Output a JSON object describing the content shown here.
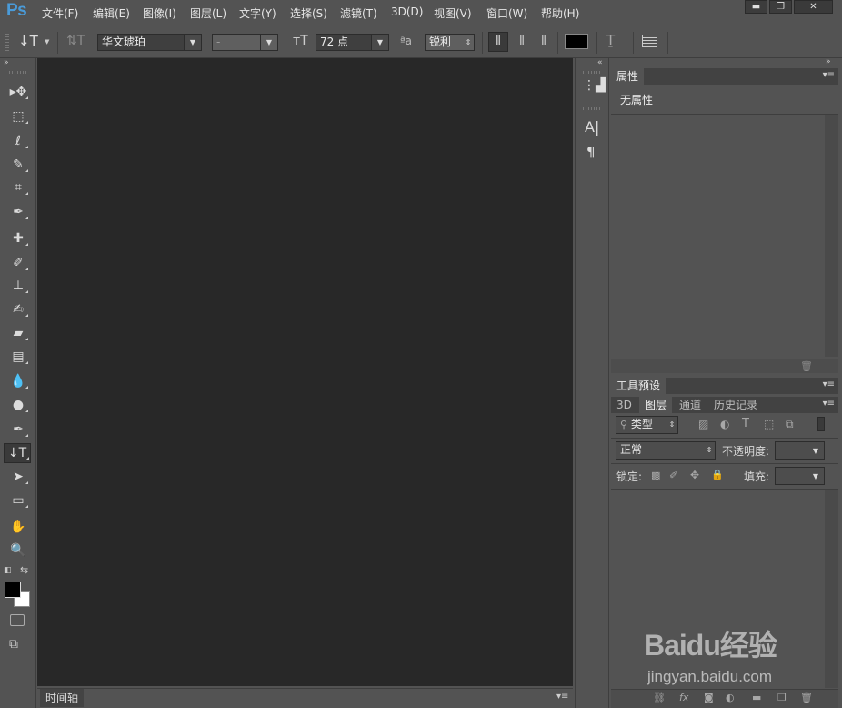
{
  "app": {
    "logo": "Ps"
  },
  "menu": [
    "文件(F)",
    "编辑(E)",
    "图像(I)",
    "图层(L)",
    "文字(Y)",
    "选择(S)",
    "滤镜(T)",
    "3D(D)",
    "视图(V)",
    "窗口(W)",
    "帮助(H)"
  ],
  "window_controls": {
    "minimize": "▬",
    "maximize": "❐",
    "close": "✕"
  },
  "options_bar": {
    "font_family": "华文琥珀",
    "font_style": "-",
    "font_size": "72 点",
    "aa_icon": "ªa",
    "antialias": "锐利",
    "text_color": "#000000"
  },
  "toolbox": {
    "tools": [
      {
        "name": "move-tool",
        "glyph": "▸✥"
      },
      {
        "name": "marquee-tool",
        "glyph": "⬚"
      },
      {
        "name": "lasso-tool",
        "glyph": "ℓ"
      },
      {
        "name": "quick-select-tool",
        "glyph": "✎"
      },
      {
        "name": "crop-tool",
        "glyph": "⌗"
      },
      {
        "name": "eyedropper-tool",
        "glyph": "✒"
      },
      {
        "name": "healing-brush-tool",
        "glyph": "✚"
      },
      {
        "name": "brush-tool",
        "glyph": "✐"
      },
      {
        "name": "clone-stamp-tool",
        "glyph": "⊥"
      },
      {
        "name": "history-brush-tool",
        "glyph": "✍"
      },
      {
        "name": "eraser-tool",
        "glyph": "▰"
      },
      {
        "name": "gradient-tool",
        "glyph": "▤"
      },
      {
        "name": "blur-tool",
        "glyph": "💧"
      },
      {
        "name": "dodge-tool",
        "glyph": "●"
      },
      {
        "name": "pen-tool",
        "glyph": "✒"
      },
      {
        "name": "type-tool",
        "glyph": "↓T"
      },
      {
        "name": "path-select-tool",
        "glyph": "➤"
      },
      {
        "name": "shape-tool",
        "glyph": "▭"
      },
      {
        "name": "hand-tool",
        "glyph": "✋"
      },
      {
        "name": "zoom-tool",
        "glyph": "🔍"
      }
    ],
    "foreground_color": "#000000",
    "background_color": "#ffffff"
  },
  "timeline": {
    "tab": "时间轴"
  },
  "icon_strip": {
    "char_icon": "A|",
    "para_icon": "¶"
  },
  "properties_panel": {
    "tab": "属性",
    "content": "无属性"
  },
  "tool_presets_panel": {
    "tab": "工具预设"
  },
  "layers_panel": {
    "tabs": [
      "3D",
      "图层",
      "通道",
      "历史记录"
    ],
    "active_tab": "图层",
    "filter_label": "类型",
    "blend_mode": "正常",
    "opacity_label": "不透明度:",
    "lock_label": "锁定:",
    "fill_label": "填充:"
  },
  "watermark": {
    "brand": "Baidu经验",
    "url": "jingyan.baidu.com"
  },
  "colors": {
    "ui_bg": "#535353",
    "canvas_bg": "#282828",
    "ps_blue": "#4a9bd9"
  }
}
